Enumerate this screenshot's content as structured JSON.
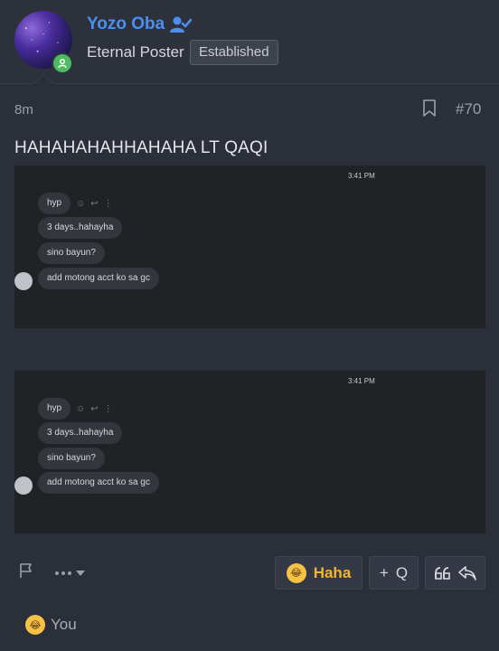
{
  "author": {
    "name": "Yozo Oba",
    "title": "Eternal Poster",
    "badge": "Established"
  },
  "post": {
    "time": "8m",
    "number": "#70",
    "title": "HAHAHAHAHHAHAHA LT QAQI"
  },
  "screenshots": [
    {
      "timestamp": "3:41 PM",
      "messages": [
        "hyp",
        "3 days..hahayha",
        "sino bayun?",
        "add motong acct ko sa gc"
      ]
    },
    {
      "timestamp": "3:41 PM",
      "messages": [
        "hyp",
        "3 days..hahayha",
        "sino bayun?",
        "add motong acct ko sa gc"
      ]
    }
  ],
  "actions": {
    "haha_label": "Haha",
    "quote_label": "Q",
    "quote_plus": "+"
  },
  "reactions": {
    "label": "You"
  },
  "colors": {
    "username": "#4d8ff0",
    "haha": "#f2b431",
    "online": "#4dbb60"
  }
}
